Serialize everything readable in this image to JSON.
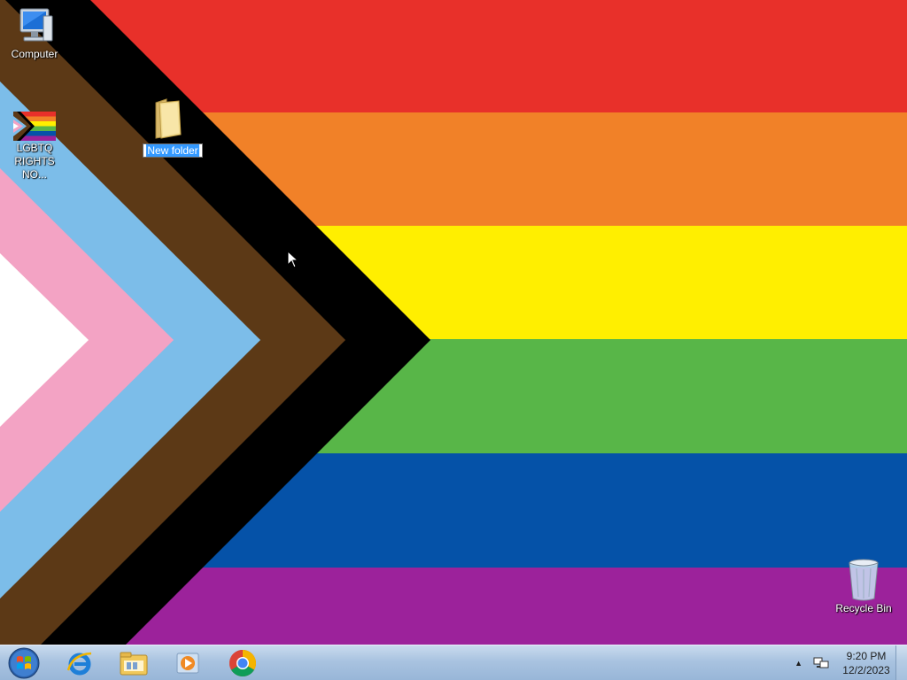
{
  "desktop": {
    "icons": {
      "computer": {
        "label": "Computer"
      },
      "shortcut": {
        "label_line1": "LGBTQ",
        "label_line2": "RIGHTS NO..."
      },
      "new_folder": {
        "label": "New folder"
      },
      "recycle_bin": {
        "label": "Recycle Bin"
      }
    }
  },
  "taskbar": {
    "pinned": [
      "Start",
      "Internet Explorer",
      "Windows Explorer",
      "Windows Media Player",
      "Google Chrome"
    ],
    "clock": {
      "time": "9:20 PM",
      "date": "12/2/2023"
    }
  },
  "colors": {
    "red": "#e8302a",
    "orange": "#f18128",
    "yellow": "#ffef00",
    "green": "#58b648",
    "blue": "#0552a8",
    "purple": "#9c229b",
    "black": "#000000",
    "brown": "#5c3916",
    "light_blue": "#7cbde9",
    "pink": "#f3a3c4",
    "white": "#ffffff"
  }
}
